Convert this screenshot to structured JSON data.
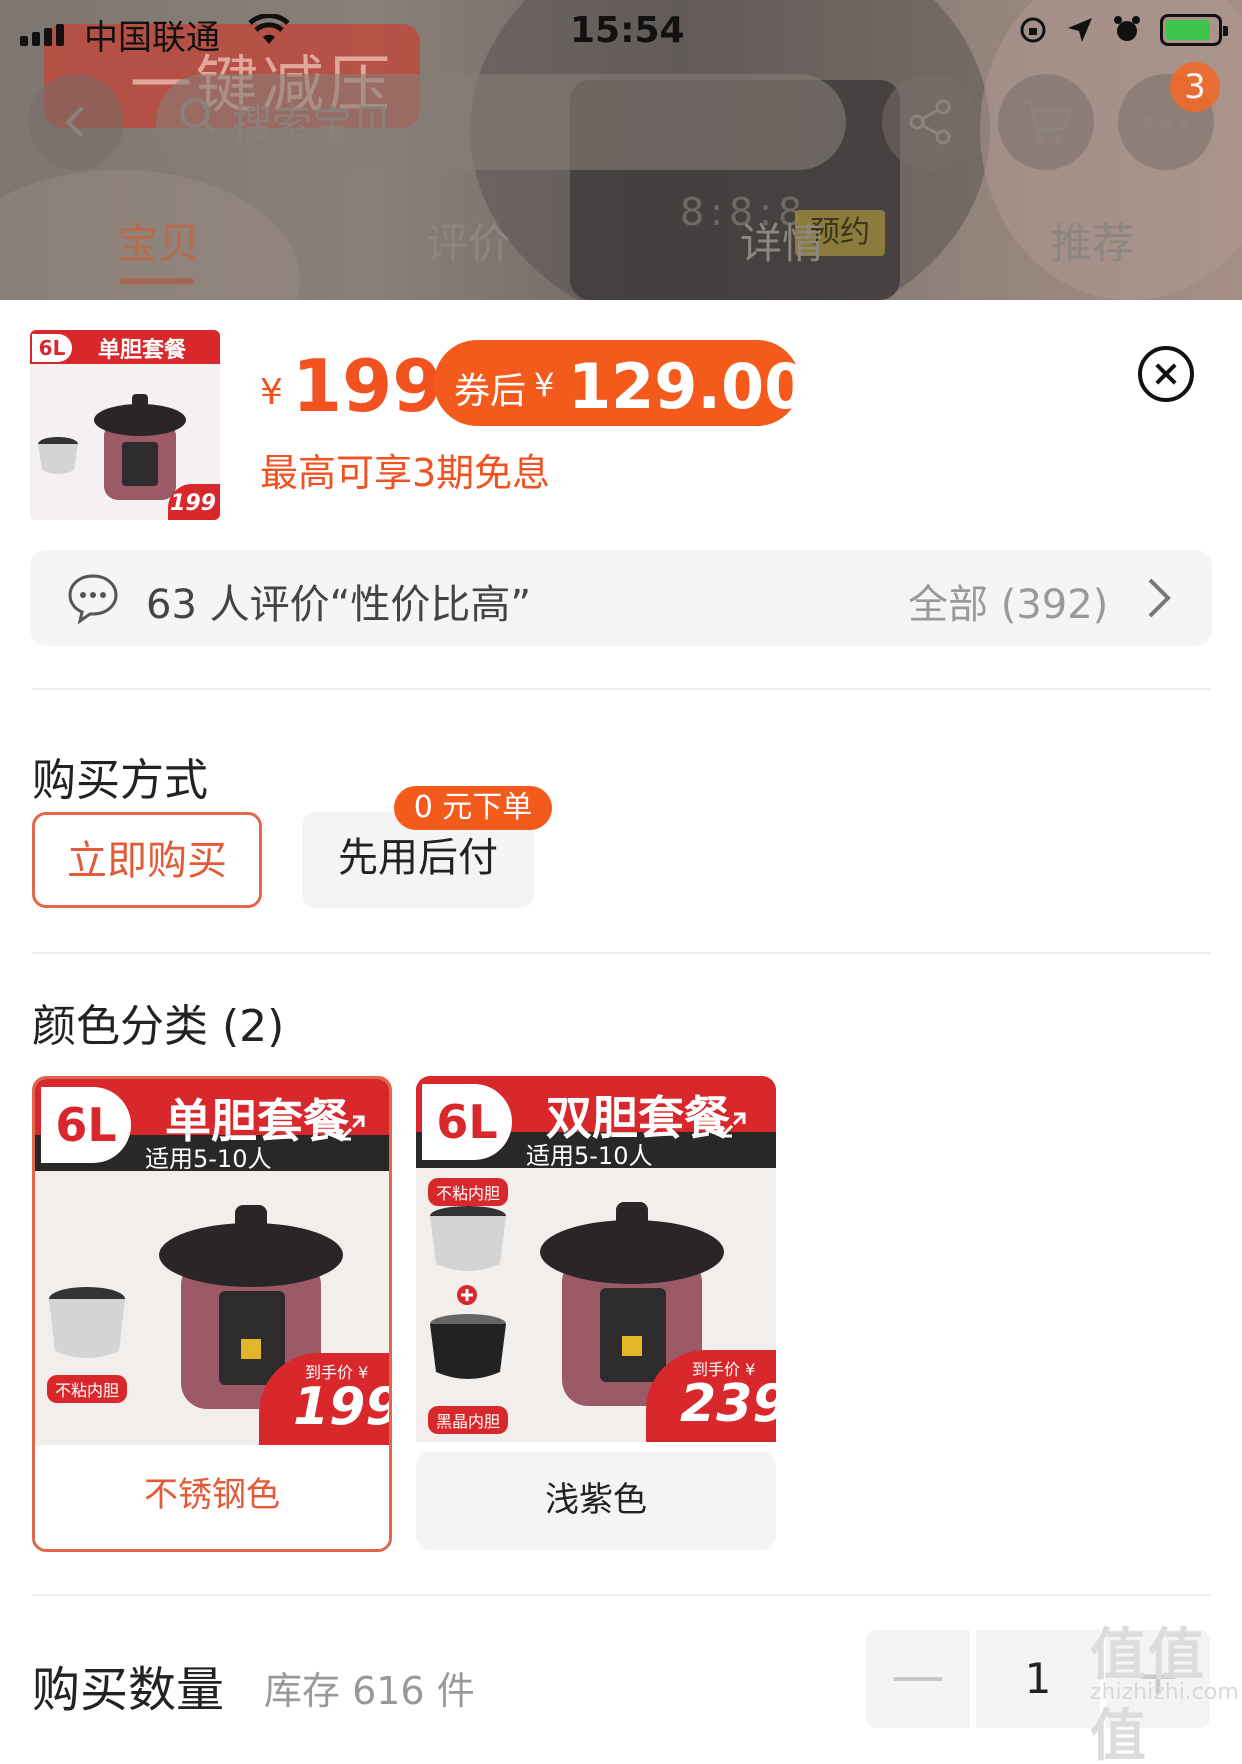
{
  "status_bar": {
    "carrier": "中国联通",
    "time": "15:54"
  },
  "background": {
    "promo_text": "一键减压",
    "panel_digits": "8:8:8",
    "panel_label": "预约"
  },
  "header": {
    "search_placeholder": "搜索宝贝",
    "cart_badge": "3",
    "tabs": [
      {
        "label": "宝贝"
      },
      {
        "label": "评价"
      },
      {
        "label": "详情"
      },
      {
        "label": "推荐"
      }
    ]
  },
  "product": {
    "thumb_badge": "6L",
    "thumb_title": "单胆套餐",
    "thumb_price": "199",
    "price_symbol": "¥",
    "price": "199",
    "coupon_label": "券后",
    "coupon_symbol": "¥",
    "coupon_price": "129.00",
    "installment": "最高可享3期免息"
  },
  "reviews": {
    "summary": "63 人评价“性价比高”",
    "all_label": "全部 (392)"
  },
  "purchase_method": {
    "title": "购买方式",
    "options": [
      {
        "label": "立即购买",
        "selected": true
      },
      {
        "label": "先用后付",
        "selected": false
      }
    ],
    "badge": "0 元下单"
  },
  "colors": {
    "title": "颜色分类 (2)",
    "items": [
      {
        "label": "不锈钢色",
        "banner": "单胆套餐",
        "size": "6L",
        "sub": "适用5-10人",
        "liner": "不粘内胆",
        "price_prefix": "到手价 ¥",
        "price": "199",
        "selected": true
      },
      {
        "label": "浅紫色",
        "banner": "双胆套餐",
        "size": "6L",
        "sub": "适用5-10人",
        "liner": "不粘内胆",
        "liner2": "黑晶内胆",
        "price_prefix": "到手价 ¥",
        "price": "239",
        "selected": false
      }
    ]
  },
  "quantity": {
    "title": "购买数量",
    "stock": "库存 616 件",
    "value": "1",
    "minus": "—",
    "plus": "+"
  },
  "watermark": {
    "big": "值值值",
    "domain": "zhizhizhi.com"
  },
  "colors_theme": {
    "accent": "#f35a1c",
    "accent_text": "#e25a38"
  }
}
